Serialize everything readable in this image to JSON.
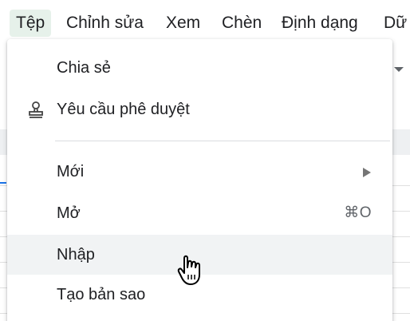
{
  "menubar": {
    "items": [
      "Tệp",
      "Chỉnh sửa",
      "Xem",
      "Chèn",
      "Định dạng",
      "Dữ"
    ]
  },
  "file_menu": {
    "share": "Chia sẻ",
    "request_approval": "Yêu cầu phê duyệt",
    "new": "Mới",
    "open": "Mở",
    "open_shortcut": "⌘O",
    "import": "Nhập",
    "make_copy": "Tạo bản sao"
  },
  "icons": {
    "request_approval": "stamp-icon",
    "new_submenu": "submenu-arrow-icon",
    "cursor": "hand-pointer-icon"
  },
  "colors": {
    "active_menu_bg": "#e6f1ea",
    "hover_item_bg": "#f1f3f4",
    "separator": "#dadce0"
  }
}
